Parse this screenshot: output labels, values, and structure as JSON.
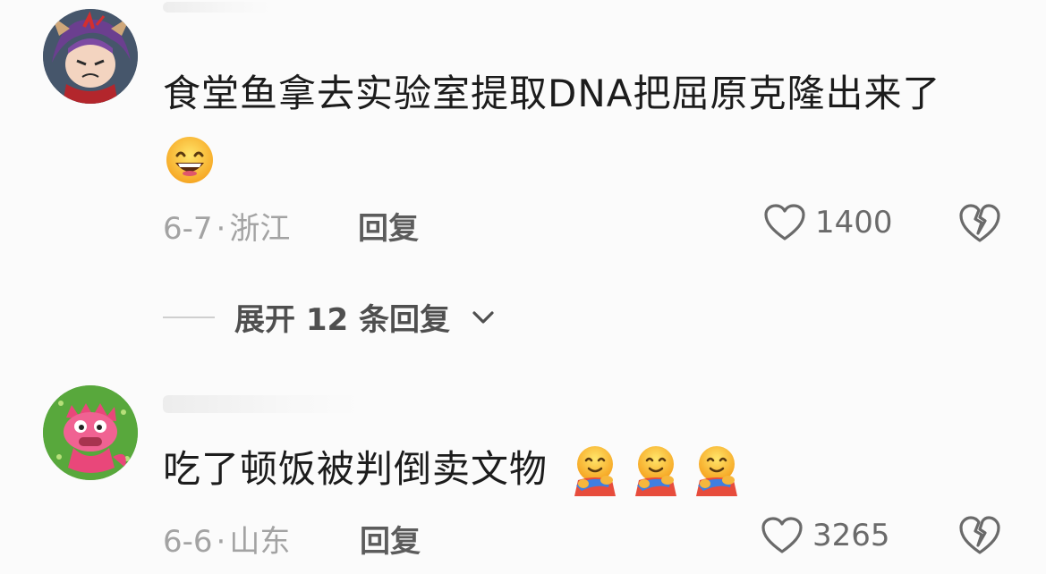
{
  "comments": [
    {
      "text": "食堂鱼拿去实验室提取DNA把屈原克隆出来了",
      "date": "6-7",
      "location": "浙江",
      "reply_label": "回复",
      "likes": "1400",
      "expand_label": "展开 12 条回复",
      "avatar_icon": "purple-hair-anime-avatar-icon",
      "emoji": "grinning-face-icon"
    },
    {
      "text": "吃了顿饭被判倒卖文物",
      "date": "6-6",
      "location": "山东",
      "reply_label": "回复",
      "likes": "3265",
      "avatar_icon": "pink-dragon-avatar-icon",
      "emoji": "hugging-face-icon"
    }
  ],
  "colors": {
    "text": "#1c1c1c",
    "meta": "#a3a3a3",
    "background": "#fbfbfb"
  }
}
